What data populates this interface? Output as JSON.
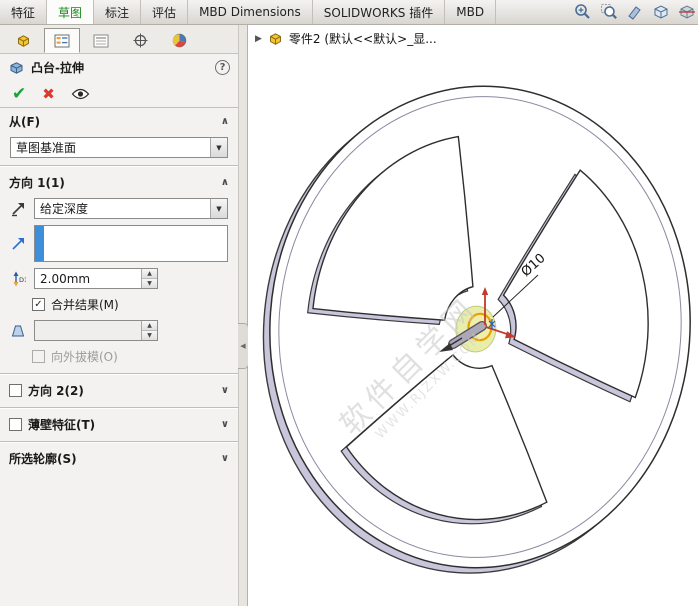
{
  "ribbon": {
    "tabs": [
      {
        "label": "特征",
        "active": false
      },
      {
        "label": "草图",
        "active": true
      },
      {
        "label": "标注",
        "active": false
      },
      {
        "label": "评估",
        "active": false
      },
      {
        "label": "MBD Dimensions",
        "active": false
      },
      {
        "label": "SOLIDWORKS 插件",
        "active": false
      },
      {
        "label": "MBD",
        "active": false
      }
    ],
    "right_icons": [
      "zoom-in-icon",
      "zoom-area-icon",
      "eraser-icon",
      "section-view-icon",
      "display-style-icon"
    ]
  },
  "colors": {
    "active_tab_green": "#1a8a1a",
    "check_green": "#17a33a",
    "cancel_red": "#df382c",
    "selection_blue": "#3d8fd9",
    "sketch_orange": "#e8a000",
    "model_lavender": "#c9c5da"
  },
  "property_manager": {
    "title": "凸台-拉伸",
    "help": "?",
    "from": {
      "label": "从(F)",
      "value": "草图基准面"
    },
    "direction1": {
      "label": "方向 1(1)",
      "end_condition": "给定深度",
      "depth": "2.00mm",
      "merge_label": "合并结果(M)",
      "merge_checked": true,
      "draft_label": "向外拔模(O)",
      "draft_checked": false
    },
    "direction2": {
      "label": "方向 2(2)",
      "checked": false
    },
    "thin_feature": {
      "label": "薄壁特征(T)",
      "checked": false
    },
    "selected_contours": {
      "label": "所选轮廓(S)"
    }
  },
  "viewport": {
    "breadcrumb": "零件2 (默认<<默认>_显...",
    "dimension": "Ø10",
    "watermark_line1": "软件自学网",
    "watermark_line2": "WWW.RJZXW.COM"
  }
}
